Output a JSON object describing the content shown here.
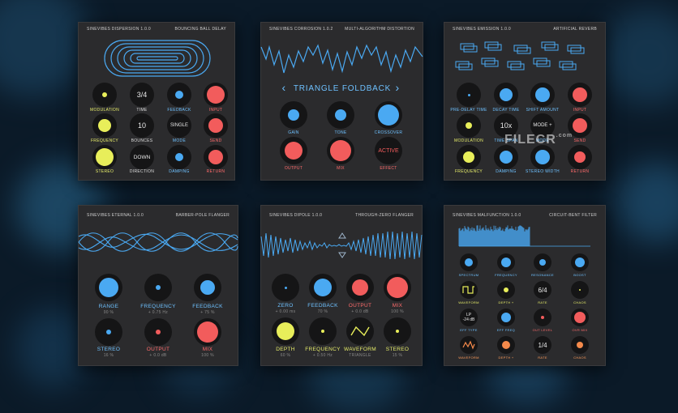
{
  "colors": {
    "blue": "#4aa9f2",
    "yellow": "#e8ee5a",
    "red": "#f25c5c",
    "orange": "#f58a4b",
    "panel": "#2b2b2d"
  },
  "dispersion": {
    "title": "SINEVIBES DISPERSION 1.0.0",
    "subtitle": "BOUNCING BALL DELAY",
    "labels": [
      "MODULATION",
      "TIME",
      "FEEDBACK",
      "INPUT",
      "FREQUENCY",
      "BOUNCES",
      "MODE",
      "SEND",
      "STEREO",
      "DIRECTION",
      "DAMPING",
      "RETURN"
    ],
    "values": {
      "time": "3/4",
      "bounces": "10",
      "mode": "SINGLE",
      "direction": "DOWN"
    }
  },
  "corrosion": {
    "title": "SINEVIBES CORROSION 1.0.2",
    "subtitle": "MULTI-ALGORITHM DISTORTION",
    "algorithm": "TRIANGLE FOLDBACK",
    "prev": "‹",
    "next": "›",
    "labels": [
      "GAIN",
      "TONE",
      "CROSSOVER",
      "OUTPUT",
      "MIX",
      "EFFECT"
    ],
    "values": {
      "effect": "ACTIVE"
    }
  },
  "emission": {
    "title": "SINEVIBES EMISSION 1.0.0",
    "subtitle": "ARTIFICIAL REVERB",
    "labels": [
      "PRE-DELAY TIME",
      "DECAY TIME",
      "SHIFT AMOUNT",
      "INPUT",
      "MODULATION",
      "TIME SPAN",
      "MODE",
      "SEND",
      "FREQUENCY",
      "DAMPING",
      "STEREO WIDTH",
      "RETURN"
    ],
    "values": {
      "time_span": "10x",
      "mode": "MODE +"
    },
    "watermark": "FILECR",
    "watermark_sub": ".com"
  },
  "eternal": {
    "title": "SINEVIBES ETERNAL 1.0.0",
    "subtitle": "BARBER-POLE FLANGER",
    "labels": [
      "RANGE",
      "FREQUENCY",
      "FEEDBACK",
      "STEREO",
      "OUTPUT",
      "MIX"
    ],
    "subs": [
      "90 %",
      "+ 0.75 Hz",
      "+ 75 %",
      "16 %",
      "+ 0.0 dB",
      "100 %"
    ]
  },
  "dipole": {
    "title": "SINEVIBES DIPOLE 1.0.0",
    "subtitle": "THROUGH-ZERO FLANGER",
    "labels": [
      "ZERO",
      "FEEDBACK",
      "OUTPUT",
      "MIX",
      "DEPTH",
      "FREQUENCY",
      "WAVEFORM",
      "STEREO"
    ],
    "subs": [
      "+ 0.00 ms",
      "70 %",
      "+ 0.0 dB",
      "100 %",
      "60 %",
      "+ 0.50 Hz",
      "TRIANGLE",
      "15 %"
    ]
  },
  "malfunction": {
    "title": "SINEVIBES MALFUNCTION 1.0.0",
    "subtitle": "CIRCUIT-BENT FILTER",
    "labels": [
      "SPECTRUM",
      "FREQUENCY",
      "RESONANCE",
      "BOOST",
      "WAVEFORM",
      "DEPTH +",
      "RATE",
      "CHAOS",
      "EFF TYPE",
      "EFF FREQ",
      "OUT LEVEL",
      "OVR MIX",
      "WAVEFORM",
      "DEPTH +",
      "RATE",
      "CHAOS"
    ],
    "values": {
      "rate1": "6/4",
      "lp": "LP",
      "lp_val": "-24 dB",
      "rate2": "1/4"
    }
  }
}
